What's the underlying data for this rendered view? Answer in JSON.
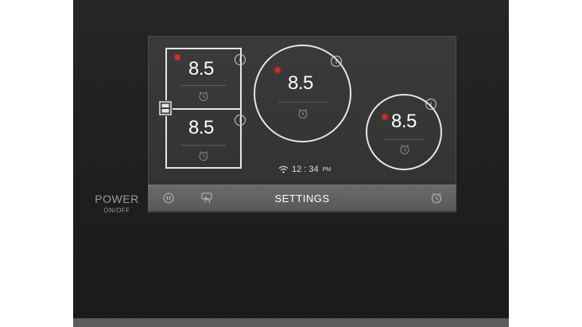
{
  "power": {
    "label": "POWER",
    "sublabel": "ON/OFF"
  },
  "zones": [
    {
      "id": "top-left",
      "shape": "square",
      "level": "8.5",
      "active": true
    },
    {
      "id": "bottom-left",
      "shape": "square",
      "level": "8.5",
      "active": false
    },
    {
      "id": "center-large",
      "shape": "circle",
      "level": "8.5",
      "active": true
    },
    {
      "id": "right-small",
      "shape": "circle",
      "level": "8.5",
      "active": true
    }
  ],
  "status": {
    "time": "12 : 34",
    "ampm": "PM",
    "icon": "wifi-icon"
  },
  "settings_bar": {
    "title": "SETTINGS",
    "left_icons": [
      "pause-icon",
      "hand-touch-icon"
    ],
    "right_icon": "alarm-timer-icon"
  },
  "colors": {
    "indicator": "#e3261b",
    "outline": "#e6e6e6",
    "screen": "#383838"
  }
}
